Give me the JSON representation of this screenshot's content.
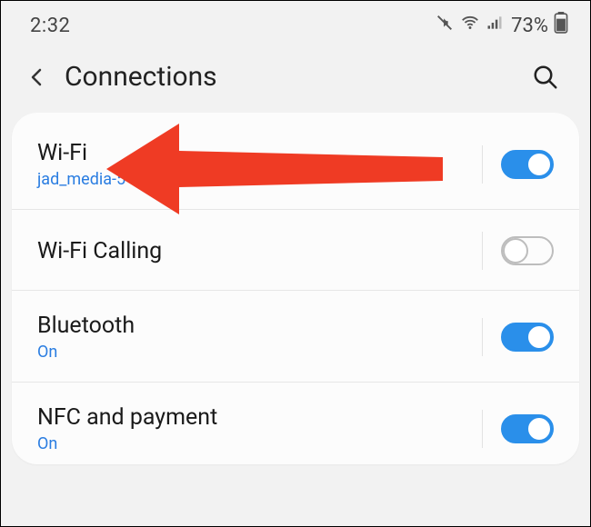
{
  "status_bar": {
    "time": "2:32",
    "battery_percent": "73%"
  },
  "header": {
    "title": "Connections"
  },
  "items": [
    {
      "title": "Wi-Fi",
      "subtitle": "jad_media-5",
      "toggle": true
    },
    {
      "title": "Wi-Fi Calling",
      "subtitle": "",
      "toggle": false
    },
    {
      "title": "Bluetooth",
      "subtitle": "On",
      "toggle": true
    },
    {
      "title": "NFC and payment",
      "subtitle": "On",
      "toggle": true
    }
  ],
  "annotation": {
    "color": "#ef3b24"
  }
}
